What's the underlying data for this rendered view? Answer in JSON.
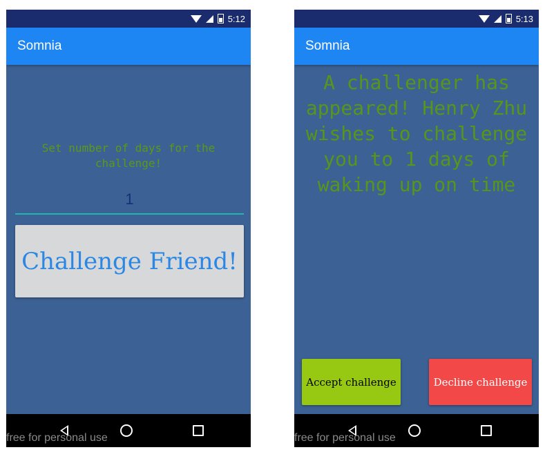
{
  "left_screen": {
    "status": {
      "time": "5:12"
    },
    "app_title": "Somnia",
    "days_label": "Set number of days for the challenge!",
    "days_value": "1",
    "challenge_button": "Challenge Friend!",
    "watermark": "free for personal use"
  },
  "right_screen": {
    "status": {
      "time": "5:13"
    },
    "app_title": "Somnia",
    "message": "A challenger has appeared! Henry Zhu wishes to challenge you to 1 days of waking up on time",
    "accept_button": "Accept challenge",
    "decline_button": "Decline challenge",
    "watermark": "free for personal use"
  },
  "colors": {
    "status_bar": "#1a2b6e",
    "app_bar": "#1e86f2",
    "background": "#3c6194",
    "text_green": "#5a9a16",
    "challenge_button_bg": "#d6d8d9",
    "challenge_button_text": "#2b87e3",
    "accept_bg": "#97c912",
    "decline_bg": "#f24848"
  }
}
